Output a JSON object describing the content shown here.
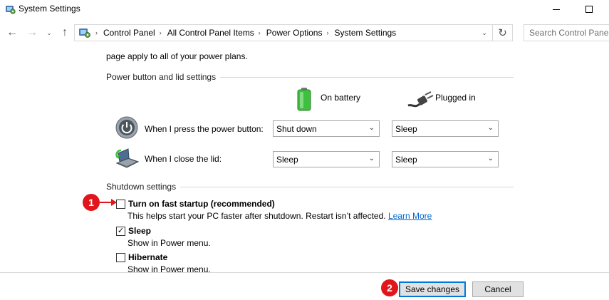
{
  "window": {
    "title": "System Settings",
    "icon": "control-panel-icon"
  },
  "address_bar": {
    "breadcrumbs": [
      "Control Panel",
      "All Control Panel Items",
      "Power Options",
      "System Settings"
    ],
    "search_placeholder": "Search Control Panel"
  },
  "content": {
    "cut_text": "page apply to all of your power plans.",
    "power_section": {
      "heading": "Power button and lid settings",
      "col_battery": "On battery",
      "col_plugged": "Plugged in",
      "rows": [
        {
          "label": "When I press the power button:",
          "battery": "Shut down",
          "plugged": "Sleep",
          "icon": "power-button-icon"
        },
        {
          "label": "When I close the lid:",
          "battery": "Sleep",
          "plugged": "Sleep",
          "icon": "laptop-lid-icon"
        }
      ]
    },
    "shutdown_section": {
      "heading": "Shutdown settings",
      "options": [
        {
          "label": "Turn on fast startup (recommended)",
          "desc": "This helps start your PC faster after shutdown. Restart isn’t affected.",
          "link": "Learn More",
          "checked": false
        },
        {
          "label": "Sleep",
          "desc": "Show in Power menu.",
          "checked": true
        },
        {
          "label": "Hibernate",
          "desc": "Show in Power menu.",
          "checked": false
        }
      ]
    }
  },
  "footer": {
    "save_label": "Save changes",
    "cancel_label": "Cancel"
  },
  "annotations": [
    "1",
    "2"
  ],
  "colors": {
    "marker": "#e0161c",
    "link": "#0066cc",
    "focus_border": "#0078d7",
    "battery_green": "#3fbf3f"
  }
}
